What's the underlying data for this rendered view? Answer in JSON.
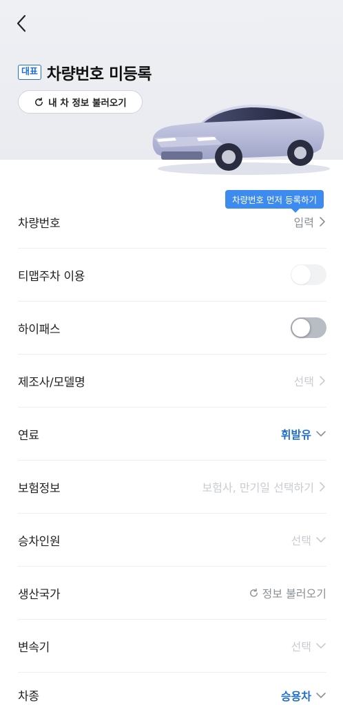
{
  "header": {
    "badge": "대표",
    "title": "차량번호 미등록",
    "load_button": "내 차 정보 불러오기"
  },
  "tooltip": "차량번호 먼저 등록하기",
  "rows": [
    {
      "label": "차량번호",
      "value": "입력",
      "control": "chevron-right"
    },
    {
      "label": "티맵주차 이용",
      "control": "toggle-disabled"
    },
    {
      "label": "하이패스",
      "control": "toggle-off"
    },
    {
      "label": "제조사/모델명",
      "value": "선택",
      "control": "chevron-right"
    },
    {
      "label": "연료",
      "value": "휘발유",
      "control": "chevron-down"
    },
    {
      "label": "보험정보",
      "value": "보험사, 만기일 선택하기",
      "control": "chevron-right"
    },
    {
      "label": "승차인원",
      "value": "선택",
      "control": "chevron-down"
    },
    {
      "label": "생산국가",
      "value": "정보 불러오기",
      "control": "refresh"
    },
    {
      "label": "변속기",
      "value": "선택",
      "control": "chevron-down"
    },
    {
      "label": "차종",
      "value": "승용차",
      "control": "chevron-down"
    }
  ],
  "colors": {
    "accent": "#1f6fd1",
    "tooltip": "#3d8bef",
    "hero_bg": "#eef0f4"
  }
}
